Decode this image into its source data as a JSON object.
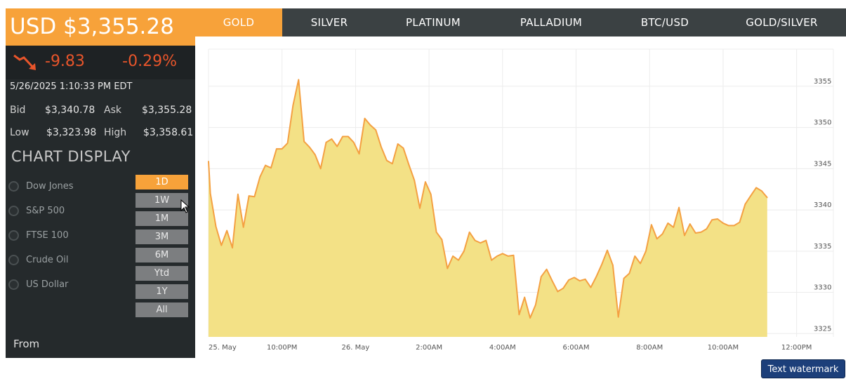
{
  "price": {
    "headline": "USD $3,355.28",
    "change_abs": "-9.83",
    "change_pct": "-0.29%",
    "timestamp": "5/26/2025 1:10:33 PM EDT"
  },
  "quotes": {
    "bid_label": "Bid",
    "bid": "$3,340.78",
    "ask_label": "Ask",
    "ask": "$3,355.28",
    "low_label": "Low",
    "low": "$3,323.98",
    "high_label": "High",
    "high": "$3,358.61"
  },
  "chart_display": {
    "title": "CHART DISPLAY",
    "overlays": [
      "Dow Jones",
      "S&P 500",
      "FTSE 100",
      "Crude Oil",
      "US Dollar"
    ],
    "ranges": [
      "1D",
      "1W",
      "1M",
      "3M",
      "6M",
      "Ytd",
      "1Y",
      "All"
    ],
    "active_range": "1D"
  },
  "from_label": "From",
  "tabs": [
    "GOLD",
    "SILVER",
    "PLATINUM",
    "PALLADIUM",
    "BTC/USD",
    "GOLD/SILVER"
  ],
  "active_tab": "GOLD",
  "watermark": "Text watermark",
  "colors": {
    "accent": "#f7a23a",
    "down": "#e8552b",
    "area_fill": "#f3e186",
    "line": "#f4a042"
  },
  "chart_data": {
    "type": "area",
    "title": "",
    "xlabel": "",
    "ylabel": "",
    "x_tick_labels": [
      "25. May",
      "10:00PM",
      "26. May",
      "2:00AM",
      "4:00AM",
      "6:00AM",
      "8:00AM",
      "10:00AM",
      "12:00PM"
    ],
    "y_ticks": [
      3325,
      3330,
      3335,
      3340,
      3345,
      3350,
      3355
    ],
    "ylim": [
      3324.6,
      3359.5
    ],
    "xlim_hours": [
      0,
      17
    ],
    "x_unit": "hours from 25. May 8:00PM",
    "grid": true,
    "series": [
      {
        "values": [
          [
            0.0,
            3345.9
          ],
          [
            0.05,
            3342.0
          ],
          [
            0.2,
            3338.0
          ],
          [
            0.35,
            3335.7
          ],
          [
            0.5,
            3337.5
          ],
          [
            0.65,
            3335.4
          ],
          [
            0.8,
            3341.9
          ],
          [
            0.95,
            3337.9
          ],
          [
            1.1,
            3341.7
          ],
          [
            1.25,
            3341.6
          ],
          [
            1.4,
            3344.0
          ],
          [
            1.55,
            3345.4
          ],
          [
            1.7,
            3345.1
          ],
          [
            1.85,
            3347.4
          ],
          [
            2.0,
            3347.4
          ],
          [
            2.15,
            3348.1
          ],
          [
            2.3,
            3352.7
          ],
          [
            2.45,
            3355.8
          ],
          [
            2.6,
            3348.3
          ],
          [
            2.75,
            3347.6
          ],
          [
            2.9,
            3346.7
          ],
          [
            3.05,
            3345.0
          ],
          [
            3.2,
            3348.2
          ],
          [
            3.35,
            3348.6
          ],
          [
            3.5,
            3347.7
          ],
          [
            3.65,
            3348.9
          ],
          [
            3.8,
            3348.9
          ],
          [
            3.95,
            3348.2
          ],
          [
            4.1,
            3346.8
          ],
          [
            4.25,
            3351.1
          ],
          [
            4.4,
            3350.3
          ],
          [
            4.55,
            3349.7
          ],
          [
            4.7,
            3347.6
          ],
          [
            4.85,
            3346.0
          ],
          [
            5.0,
            3345.6
          ],
          [
            5.15,
            3348.0
          ],
          [
            5.3,
            3347.5
          ],
          [
            5.45,
            3345.5
          ],
          [
            5.6,
            3343.6
          ],
          [
            5.75,
            3340.2
          ],
          [
            5.9,
            3343.4
          ],
          [
            6.05,
            3341.9
          ],
          [
            6.2,
            3337.3
          ],
          [
            6.35,
            3336.4
          ],
          [
            6.5,
            3332.9
          ],
          [
            6.65,
            3334.4
          ],
          [
            6.8,
            3333.9
          ],
          [
            6.95,
            3335.0
          ],
          [
            7.1,
            3337.3
          ],
          [
            7.25,
            3336.3
          ],
          [
            7.4,
            3336.0
          ],
          [
            7.55,
            3336.3
          ],
          [
            7.7,
            3333.9
          ],
          [
            7.85,
            3334.4
          ],
          [
            8.0,
            3334.7
          ],
          [
            8.15,
            3334.4
          ],
          [
            8.3,
            3334.5
          ],
          [
            8.45,
            3327.3
          ],
          [
            8.6,
            3329.4
          ],
          [
            8.75,
            3326.9
          ],
          [
            8.9,
            3328.5
          ],
          [
            9.05,
            3331.9
          ],
          [
            9.2,
            3332.8
          ],
          [
            9.35,
            3331.4
          ],
          [
            9.5,
            3330.1
          ],
          [
            9.65,
            3330.5
          ],
          [
            9.8,
            3331.5
          ],
          [
            9.95,
            3331.8
          ],
          [
            10.1,
            3331.4
          ],
          [
            10.25,
            3331.6
          ],
          [
            10.4,
            3330.6
          ],
          [
            10.55,
            3331.9
          ],
          [
            10.7,
            3333.4
          ],
          [
            10.85,
            3335.1
          ],
          [
            11.0,
            3333.3
          ],
          [
            11.15,
            3327.0
          ],
          [
            11.3,
            3331.7
          ],
          [
            11.45,
            3332.3
          ],
          [
            11.6,
            3334.4
          ],
          [
            11.75,
            3333.5
          ],
          [
            11.9,
            3335.0
          ],
          [
            12.05,
            3338.2
          ],
          [
            12.2,
            3336.5
          ],
          [
            12.35,
            3337.1
          ],
          [
            12.5,
            3338.4
          ],
          [
            12.65,
            3337.9
          ],
          [
            12.8,
            3340.3
          ],
          [
            12.95,
            3336.9
          ],
          [
            13.1,
            3338.3
          ],
          [
            13.25,
            3337.2
          ],
          [
            13.4,
            3337.3
          ],
          [
            13.55,
            3337.7
          ],
          [
            13.7,
            3338.8
          ],
          [
            13.85,
            3338.9
          ],
          [
            14.0,
            3338.4
          ],
          [
            14.15,
            3338.1
          ],
          [
            14.3,
            3338.1
          ],
          [
            14.45,
            3338.5
          ],
          [
            14.6,
            3340.7
          ],
          [
            14.75,
            3341.7
          ],
          [
            14.9,
            3342.7
          ],
          [
            15.05,
            3342.3
          ],
          [
            15.2,
            3341.5
          ]
        ]
      }
    ]
  }
}
